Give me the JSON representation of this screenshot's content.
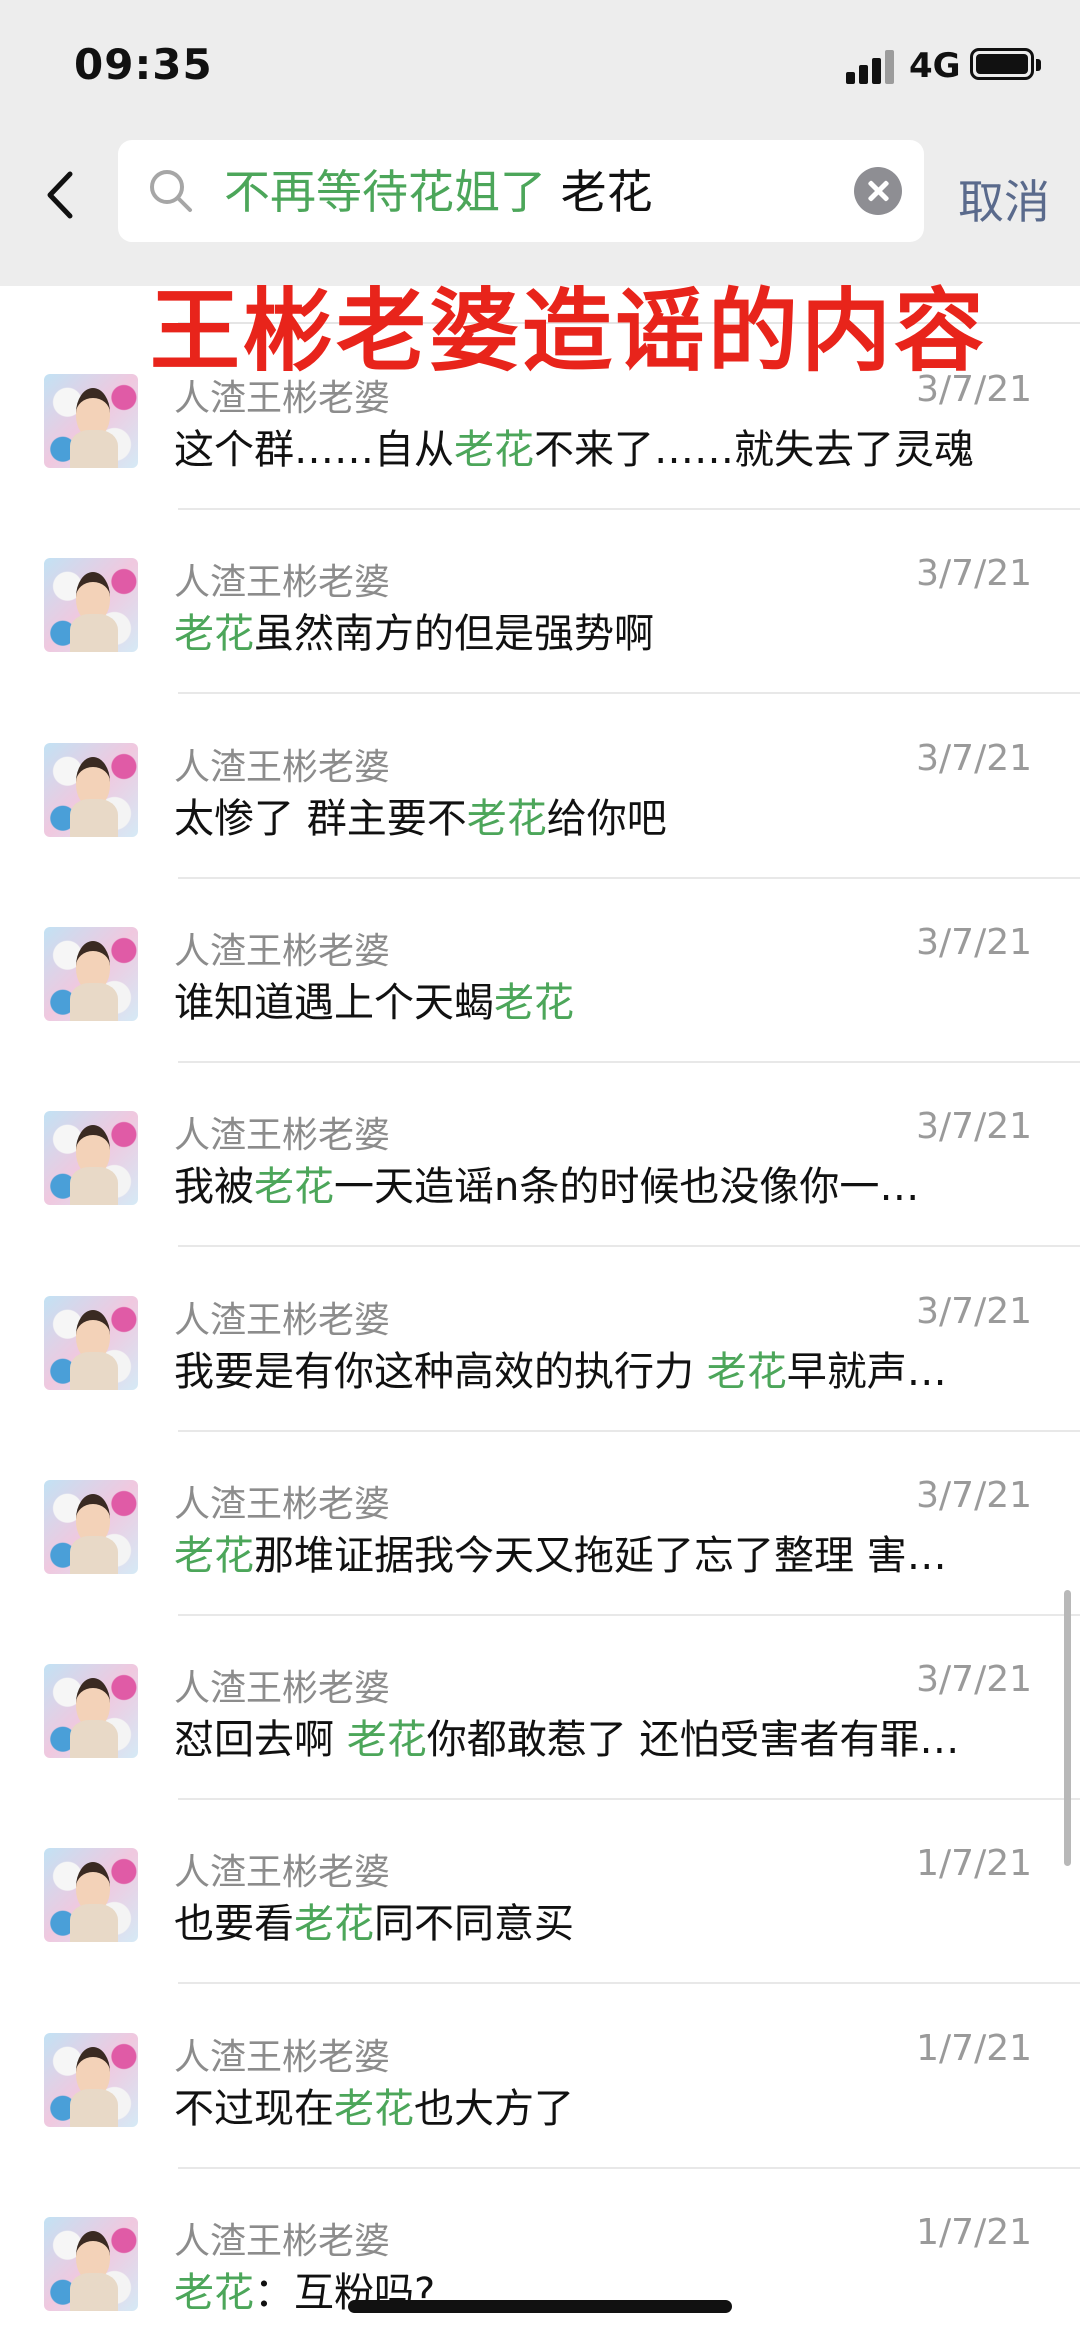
{
  "status_bar": {
    "time": "09:35",
    "network": "4G",
    "icons": [
      "signal-bars-icon",
      "battery-icon"
    ]
  },
  "search": {
    "tag": "不再等待花姐了",
    "keyword": "老花",
    "cancel_label": "取消",
    "icons": [
      "back-chevron-icon",
      "search-icon",
      "clear-icon"
    ]
  },
  "overlay": {
    "title": "王彬老婆造谣的内容"
  },
  "messages": [
    {
      "sender": "人渣王彬老婆",
      "date": "3/7/21",
      "parts": [
        {
          "t": "这个群……自从"
        },
        {
          "t": "老花",
          "h": true
        },
        {
          "t": "不来了……就失去了灵魂"
        }
      ]
    },
    {
      "sender": "人渣王彬老婆",
      "date": "3/7/21",
      "parts": [
        {
          "t": "老花",
          "h": true
        },
        {
          "t": "虽然南方的但是强势啊"
        }
      ]
    },
    {
      "sender": "人渣王彬老婆",
      "date": "3/7/21",
      "parts": [
        {
          "t": "太惨了 群主要不"
        },
        {
          "t": "老花",
          "h": true
        },
        {
          "t": "给你吧"
        }
      ]
    },
    {
      "sender": "人渣王彬老婆",
      "date": "3/7/21",
      "parts": [
        {
          "t": "谁知道遇上个天蝎"
        },
        {
          "t": "老花",
          "h": true
        }
      ]
    },
    {
      "sender": "人渣王彬老婆",
      "date": "3/7/21",
      "parts": [
        {
          "t": "我被"
        },
        {
          "t": "老花",
          "h": true
        },
        {
          "t": "一天造谣n条的时候也没像你一…"
        }
      ]
    },
    {
      "sender": "人渣王彬老婆",
      "date": "3/7/21",
      "parts": [
        {
          "t": "我要是有你这种高效的执行力 "
        },
        {
          "t": "老花",
          "h": true
        },
        {
          "t": "早就声…"
        }
      ]
    },
    {
      "sender": "人渣王彬老婆",
      "date": "3/7/21",
      "parts": [
        {
          "t": "老花",
          "h": true
        },
        {
          "t": "那堆证据我今天又拖延了忘了整理 害…"
        }
      ]
    },
    {
      "sender": "人渣王彬老婆",
      "date": "3/7/21",
      "parts": [
        {
          "t": "怼回去啊 "
        },
        {
          "t": "老花",
          "h": true
        },
        {
          "t": "你都敢惹了 还怕受害者有罪…"
        }
      ]
    },
    {
      "sender": "人渣王彬老婆",
      "date": "1/7/21",
      "parts": [
        {
          "t": "也要看"
        },
        {
          "t": "老花",
          "h": true
        },
        {
          "t": "同不同意买"
        }
      ]
    },
    {
      "sender": "人渣王彬老婆",
      "date": "1/7/21",
      "parts": [
        {
          "t": "不过现在"
        },
        {
          "t": "老花",
          "h": true
        },
        {
          "t": "也大方了"
        }
      ]
    },
    {
      "sender": "人渣王彬老婆",
      "date": "1/7/21",
      "parts": [
        {
          "t": "老花",
          "h": true
        },
        {
          "t": "：互粉吗?"
        }
      ]
    }
  ]
}
